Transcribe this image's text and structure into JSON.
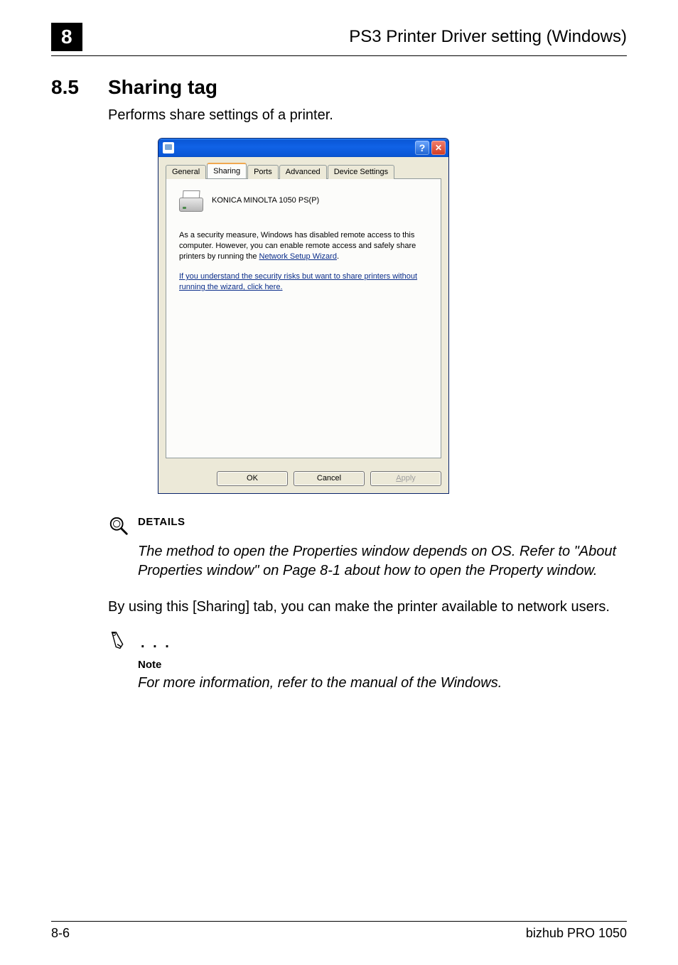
{
  "header": {
    "chapter": "8",
    "title": "PS3 Printer Driver setting (Windows)"
  },
  "section": {
    "number": "8.5",
    "title": "Sharing tag",
    "intro": "Performs share settings of a printer."
  },
  "dialog": {
    "tabs": {
      "general": "General",
      "sharing": "Sharing",
      "ports": "Ports",
      "advanced": "Advanced",
      "device": "Device Settings"
    },
    "active_tab": "Sharing",
    "printer_name": "KONICA MINOLTA 1050 PS(P)",
    "text1_a": "As a security measure, Windows has disabled remote access to this computer. However, you can enable remote access and safely share printers by running the ",
    "text1_link": "Network Setup Wizard",
    "text1_b": ".",
    "text2_link": "If you understand the security risks but want to share printers without running the wizard, click here.",
    "buttons": {
      "ok": "OK",
      "cancel": "Cancel",
      "apply": "pply",
      "apply_accel": "A"
    }
  },
  "details": {
    "label": "DETAILS",
    "text": "The method to open the Properties window depends on OS. Refer to \"About Properties window\" on Page 8-1 about how to open the Property window."
  },
  "body_para": "By using this [Sharing] tab, you can make the printer available to network users.",
  "note": {
    "label": "Note",
    "text": "For more information, refer to the manual of the Windows."
  },
  "footer": {
    "left": "8-6",
    "right": "bizhub PRO 1050"
  }
}
